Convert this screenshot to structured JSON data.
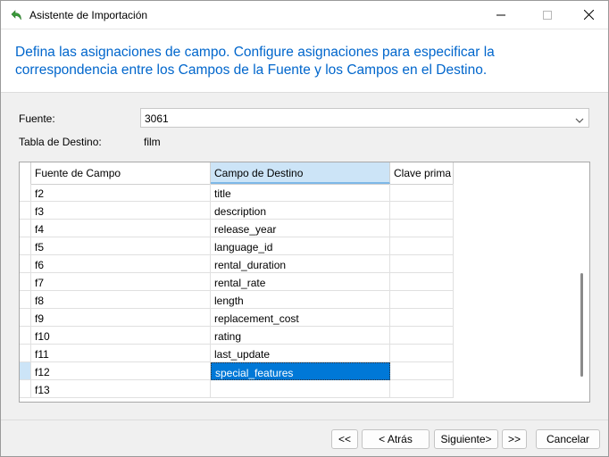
{
  "window": {
    "title": "Asistente de Importación"
  },
  "header": {
    "instruction": "Defina las asignaciones de campo. Configure asignaciones para especificar la correspondencia entre los Campos de la Fuente y los Campos en el Destino."
  },
  "form": {
    "source_label": "Fuente:",
    "source_value": "3061",
    "dest_table_label": "Tabla de Destino:",
    "dest_table_value": "film"
  },
  "grid": {
    "columns": [
      "Fuente de Campo",
      "Campo de Destino",
      "Clave prima"
    ],
    "rows": [
      {
        "source": "f2",
        "dest": "title",
        "key": ""
      },
      {
        "source": "f3",
        "dest": "description",
        "key": ""
      },
      {
        "source": "f4",
        "dest": "release_year",
        "key": ""
      },
      {
        "source": "f5",
        "dest": "language_id",
        "key": ""
      },
      {
        "source": "f6",
        "dest": "rental_duration",
        "key": ""
      },
      {
        "source": "f7",
        "dest": "rental_rate",
        "key": ""
      },
      {
        "source": "f8",
        "dest": "length",
        "key": ""
      },
      {
        "source": "f9",
        "dest": "replacement_cost",
        "key": ""
      },
      {
        "source": "f10",
        "dest": "rating",
        "key": ""
      },
      {
        "source": "f11",
        "dest": "last_update",
        "key": ""
      },
      {
        "source": "f12",
        "dest": "special_features",
        "key": ""
      },
      {
        "source": "f13",
        "dest": "",
        "key": ""
      }
    ]
  },
  "buttons": {
    "first": "<<",
    "back": "< Atrás",
    "next": "Siguiente>",
    "last": ">>",
    "cancel": "Cancelar"
  },
  "colors": {
    "accent": "#0066cc",
    "selection": "#0078d7",
    "header_active": "#cce4f7"
  }
}
